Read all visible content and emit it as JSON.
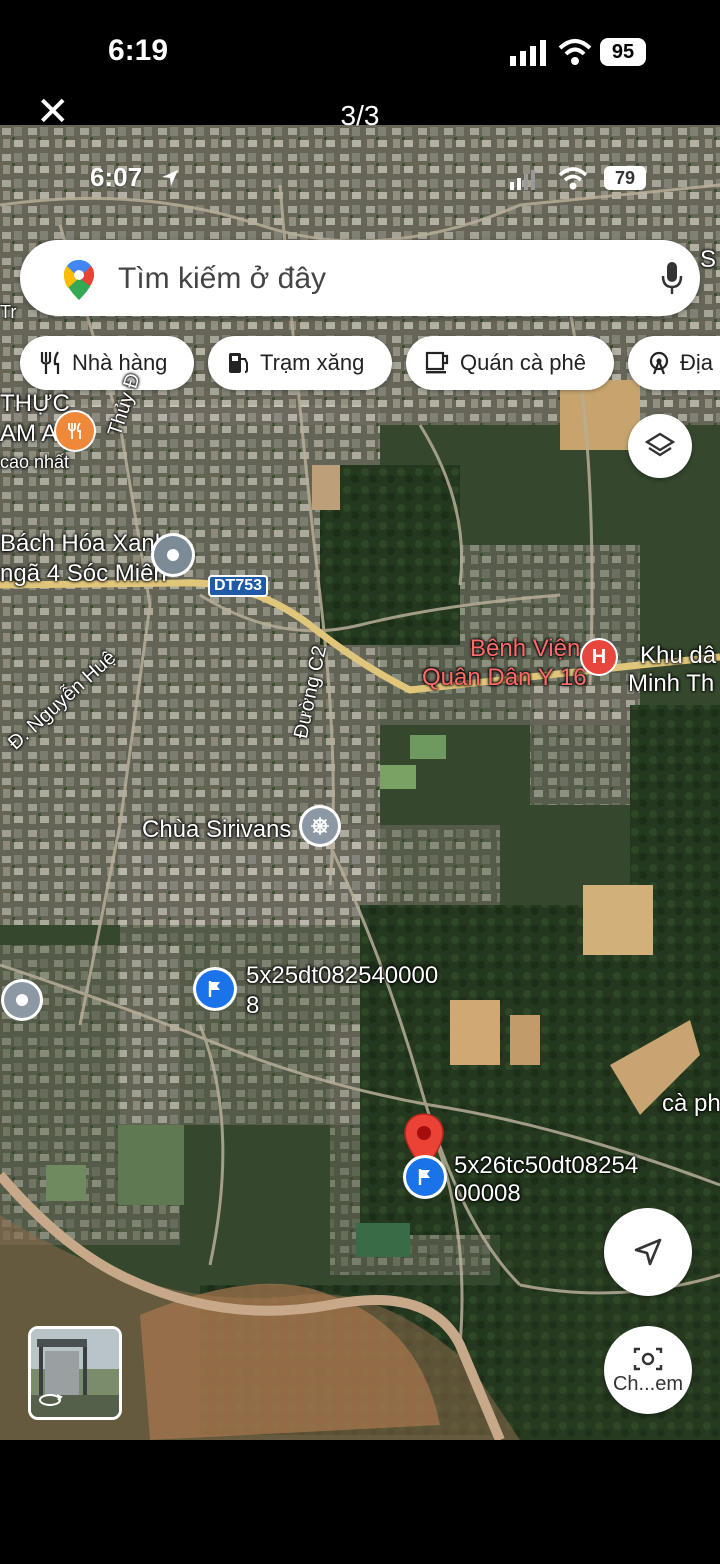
{
  "outer_status": {
    "time": "6:19",
    "battery": "95"
  },
  "viewer": {
    "counter": "3/3"
  },
  "inner_status": {
    "time": "6:07",
    "battery": "79"
  },
  "search": {
    "placeholder": "Tìm kiếm ở đây"
  },
  "chips": [
    {
      "label": "Nhà hàng",
      "icon": "fork-knife-icon"
    },
    {
      "label": "Trạm xăng",
      "icon": "gas-pump-icon"
    },
    {
      "label": "Quán cà phê",
      "icon": "coffee-cup-icon"
    },
    {
      "label": "Địa",
      "icon": "attraction-icon"
    }
  ],
  "map_labels": {
    "thuc_line1": "THỰC",
    "thuc_line2": "AM AN",
    "thuc_line3": "cao nhất",
    "thuy_do": "Thủy Đ",
    "bach_hoa_line1": "Bách Hóa Xanh",
    "bach_hoa_line2": "ngã 4 Sóc Miên",
    "road_dt753": "DT753",
    "nguyen_hue": "Đ. Nguyễn Huệ",
    "duong_c2": "Đường C2",
    "benh_vien_line1": "Bệnh Viện",
    "benh_vien_line2": "Quân Dân Y 16",
    "khu_line1": "Khu dâ",
    "khu_line2": "Minh Th",
    "chua": "Chùa Sirivans",
    "lot1_line1": "5x25dt082540000",
    "lot1_line2": "8",
    "lot2_line1": "5x26tc50dt08254",
    "lot2_line2": "00008",
    "caphe": "cà ph",
    "edge_s": "S",
    "edge_t": "Tr",
    "camera_btn": "Ch...em"
  },
  "colors": {
    "accent_blue": "#1a73e8",
    "pin_red": "#ea4335",
    "hospital_red": "#e8453c",
    "restaurant_orange": "#f0883a"
  }
}
